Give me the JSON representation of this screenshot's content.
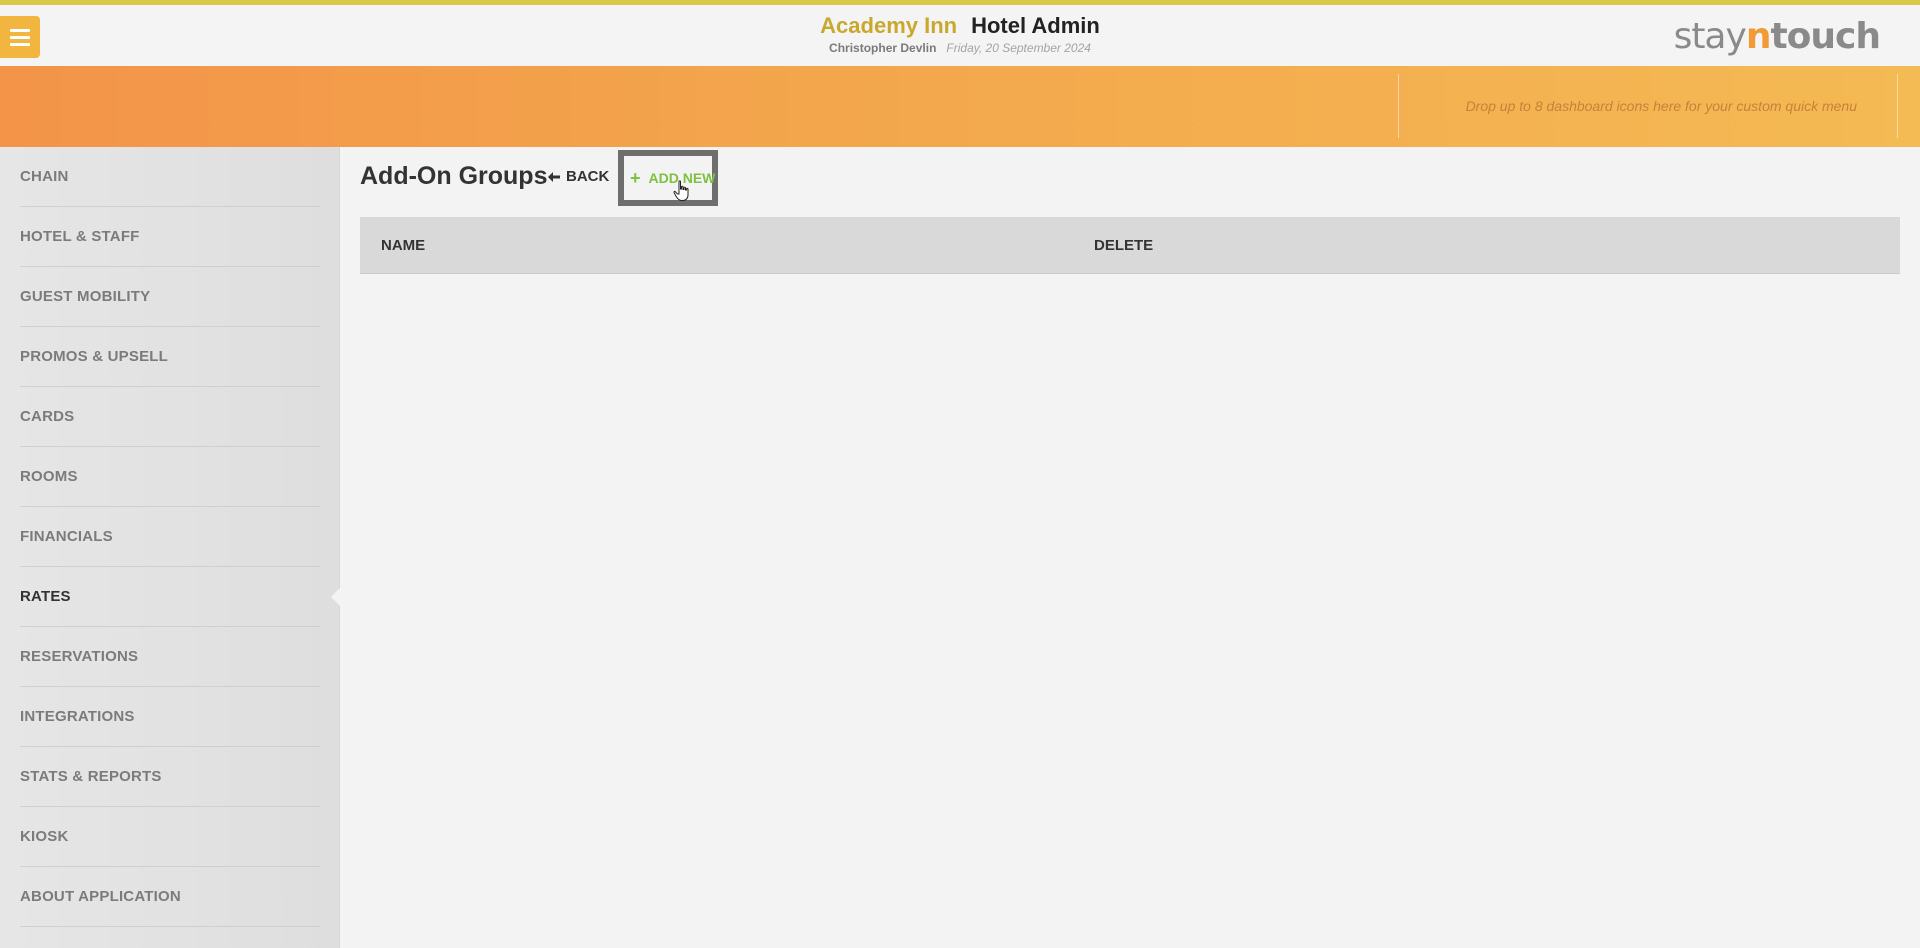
{
  "header": {
    "hotel_name": "Academy Inn",
    "app_title": "Hotel Admin",
    "user": "Christopher Devlin",
    "date": "Friday, 20 September 2024",
    "logo_stay": "stay",
    "logo_n": "n",
    "logo_touch": "touch"
  },
  "quick_menu": {
    "hint": "Drop up to 8 dashboard icons here for your custom quick menu"
  },
  "sidebar": {
    "items": [
      {
        "label": "CHAIN"
      },
      {
        "label": "HOTEL & STAFF"
      },
      {
        "label": "GUEST MOBILITY"
      },
      {
        "label": "PROMOS & UPSELL"
      },
      {
        "label": "CARDS"
      },
      {
        "label": "ROOMS"
      },
      {
        "label": "FINANCIALS"
      },
      {
        "label": "RATES"
      },
      {
        "label": "RESERVATIONS"
      },
      {
        "label": "INTEGRATIONS"
      },
      {
        "label": "STATS & REPORTS"
      },
      {
        "label": "KIOSK"
      },
      {
        "label": "ABOUT APPLICATION"
      }
    ],
    "active": "RATES"
  },
  "main": {
    "title": "Add-On Groups",
    "back_label": "BACK",
    "add_new_label": "ADD NEW",
    "table": {
      "columns": [
        "NAME",
        "DELETE"
      ],
      "rows": []
    }
  },
  "colors": {
    "accent_gold": "#c8a92e",
    "band_orange": "#f39449",
    "add_green": "#7dc13f",
    "menu_button": "#f2b53f"
  },
  "icons": {
    "menu": "hamburger-icon",
    "back": "arrow-left-icon",
    "add": "plus-icon",
    "cursor": "hand-pointer-icon"
  }
}
